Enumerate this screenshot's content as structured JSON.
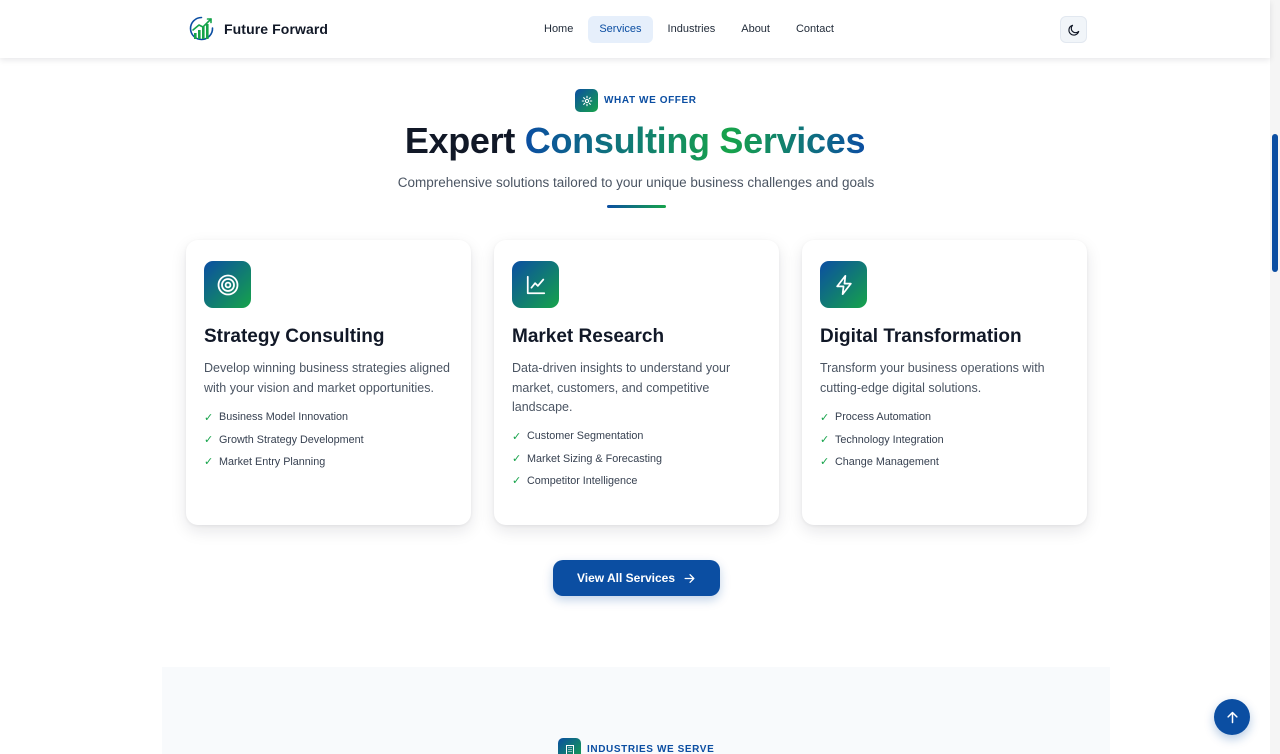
{
  "brand": {
    "name": "Future Forward",
    "logo_icon": "growth-chart-icon"
  },
  "nav": {
    "items": [
      {
        "label": "Home",
        "active": false
      },
      {
        "label": "Services",
        "active": true
      },
      {
        "label": "Industries",
        "active": false
      },
      {
        "label": "About",
        "active": false
      },
      {
        "label": "Contact",
        "active": false
      }
    ],
    "theme_toggle_icon": "moon-icon"
  },
  "section": {
    "eyebrow": "WHAT WE OFFER",
    "eyebrow_icon": "gear-icon",
    "title_part1": "Expert",
    "title_part2": "Consulting Services",
    "subtitle": "Comprehensive solutions tailored to your unique business challenges and goals"
  },
  "cards": [
    {
      "icon": "target-icon",
      "title": "Strategy Consulting",
      "description": "Develop winning business strategies aligned with your vision and market opportunities.",
      "features": [
        "Business Model Innovation",
        "Growth Strategy Development",
        "Market Entry Planning"
      ]
    },
    {
      "icon": "line-chart-icon",
      "title": "Market Research",
      "description": "Data-driven insights to understand your market, customers, and competitive landscape.",
      "features": [
        "Customer Segmentation",
        "Market Sizing & Forecasting",
        "Competitor Intelligence"
      ]
    },
    {
      "icon": "lightning-icon",
      "title": "Digital Transformation",
      "description": "Transform your business operations with cutting-edge digital solutions.",
      "features": [
        "Process Automation",
        "Technology Integration",
        "Change Management"
      ]
    }
  ],
  "check_mark": "✓",
  "cta": {
    "label": "View All Services",
    "icon": "arrow-right-icon"
  },
  "next_section": {
    "eyebrow": "INDUSTRIES WE SERVE",
    "eyebrow_icon": "building-icon"
  },
  "back_to_top_icon": "arrow-up-icon",
  "colors": {
    "primary": "#0b4ea2",
    "accent": "#16a34a",
    "text": "#111827",
    "muted": "#4b5563"
  }
}
